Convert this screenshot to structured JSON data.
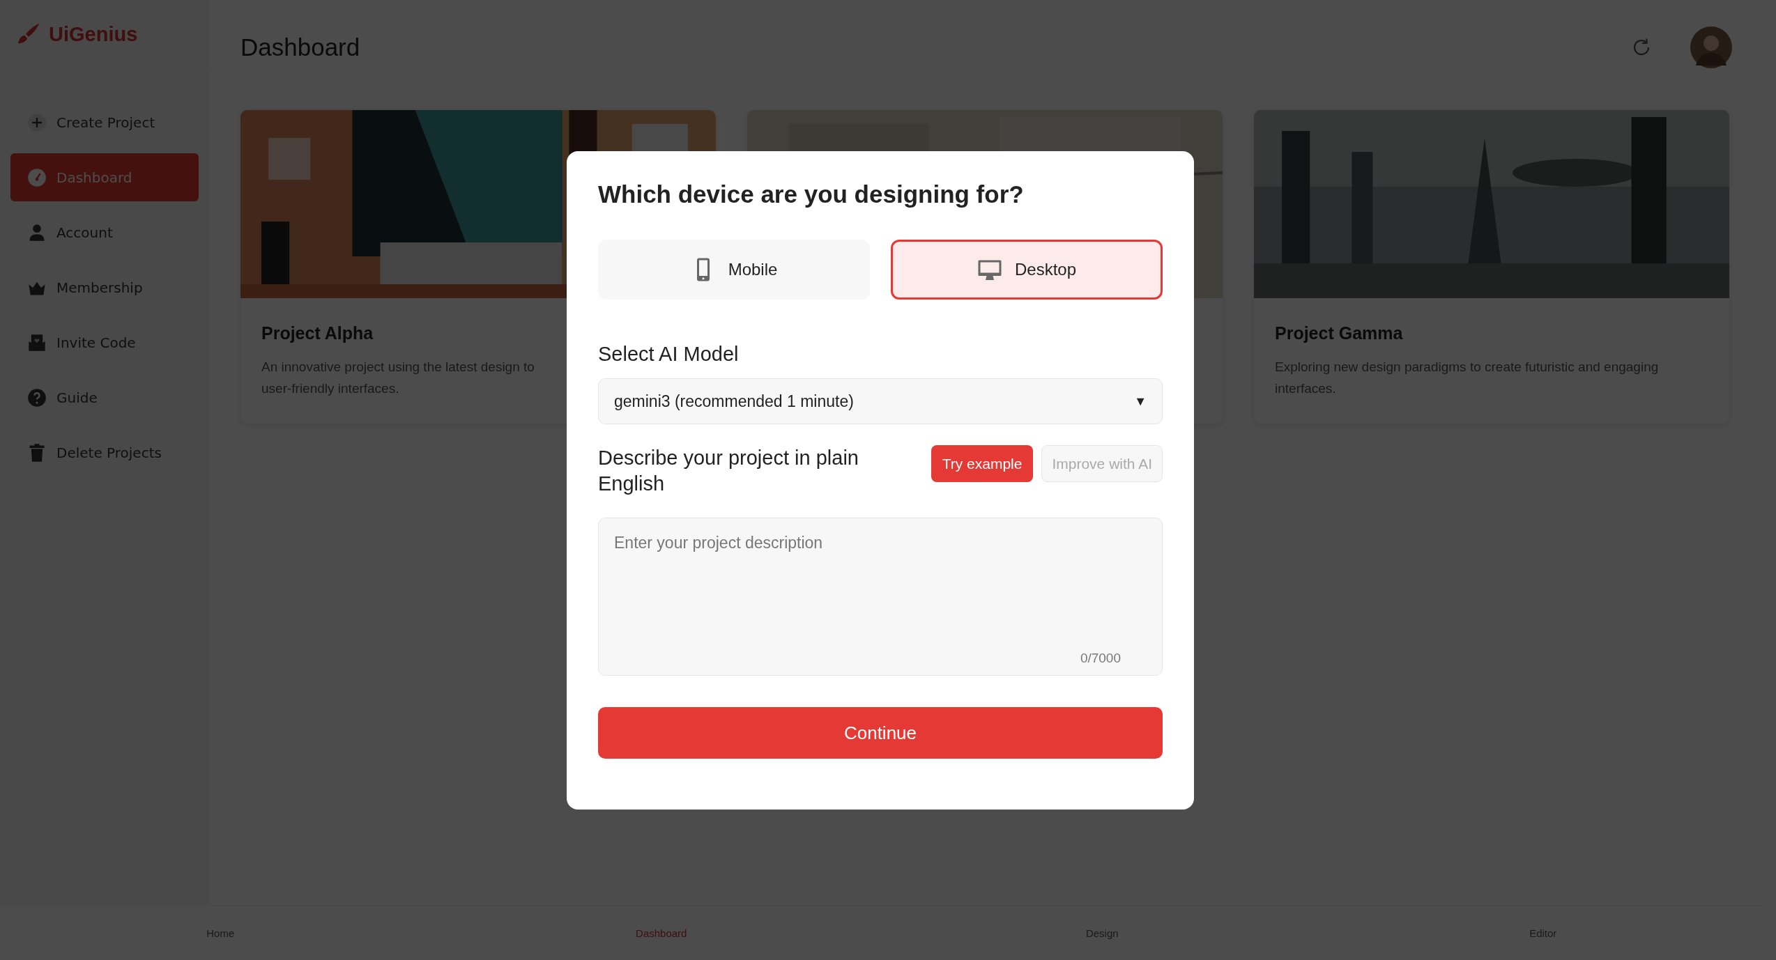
{
  "app": {
    "logo": "UiGenius"
  },
  "sidebar": {
    "items": [
      {
        "label": "Create Project",
        "selected": false
      },
      {
        "label": "Dashboard",
        "selected": true
      },
      {
        "label": "Account",
        "selected": false
      },
      {
        "label": "Membership",
        "selected": false
      },
      {
        "label": "Invite Code",
        "selected": false
      },
      {
        "label": "Guide",
        "selected": false
      },
      {
        "label": "Delete Projects",
        "selected": false
      }
    ]
  },
  "header": {
    "title": "Dashboard"
  },
  "projects": [
    {
      "kind": "card",
      "title": "Project Alpha",
      "lines": [
        "An innovative project using the latest design to",
        "user-friendly interfaces."
      ]
    },
    {
      "kind": "picture"
    },
    {
      "kind": "card",
      "title": "Project Gamma",
      "lines": [
        "Exploring new design paradigms to create futuristic and engaging",
        "interfaces."
      ]
    }
  ],
  "modal": {
    "title": "Which device are you designing for?",
    "devices": [
      {
        "label": "Mobile",
        "selected": false
      },
      {
        "label": "Desktop",
        "selected": true
      }
    ],
    "model_label": "Select AI Model",
    "model_value": "gemini3 (recommended 1 minute)",
    "dropdown_arrow": "▼",
    "describe_label": "Describe your project in plain English",
    "try_button": "Try example",
    "improve_button": {
      "label": "Improve with AI",
      "disabled": true
    },
    "placeholder": "Enter your project description",
    "counter": "0/7000",
    "continue": "Continue"
  },
  "bottom_nav": [
    {
      "label": "Home",
      "selected": false
    },
    {
      "label": "Dashboard",
      "selected": true
    },
    {
      "label": "Design",
      "selected": false
    },
    {
      "label": "Editor",
      "selected": false
    }
  ]
}
